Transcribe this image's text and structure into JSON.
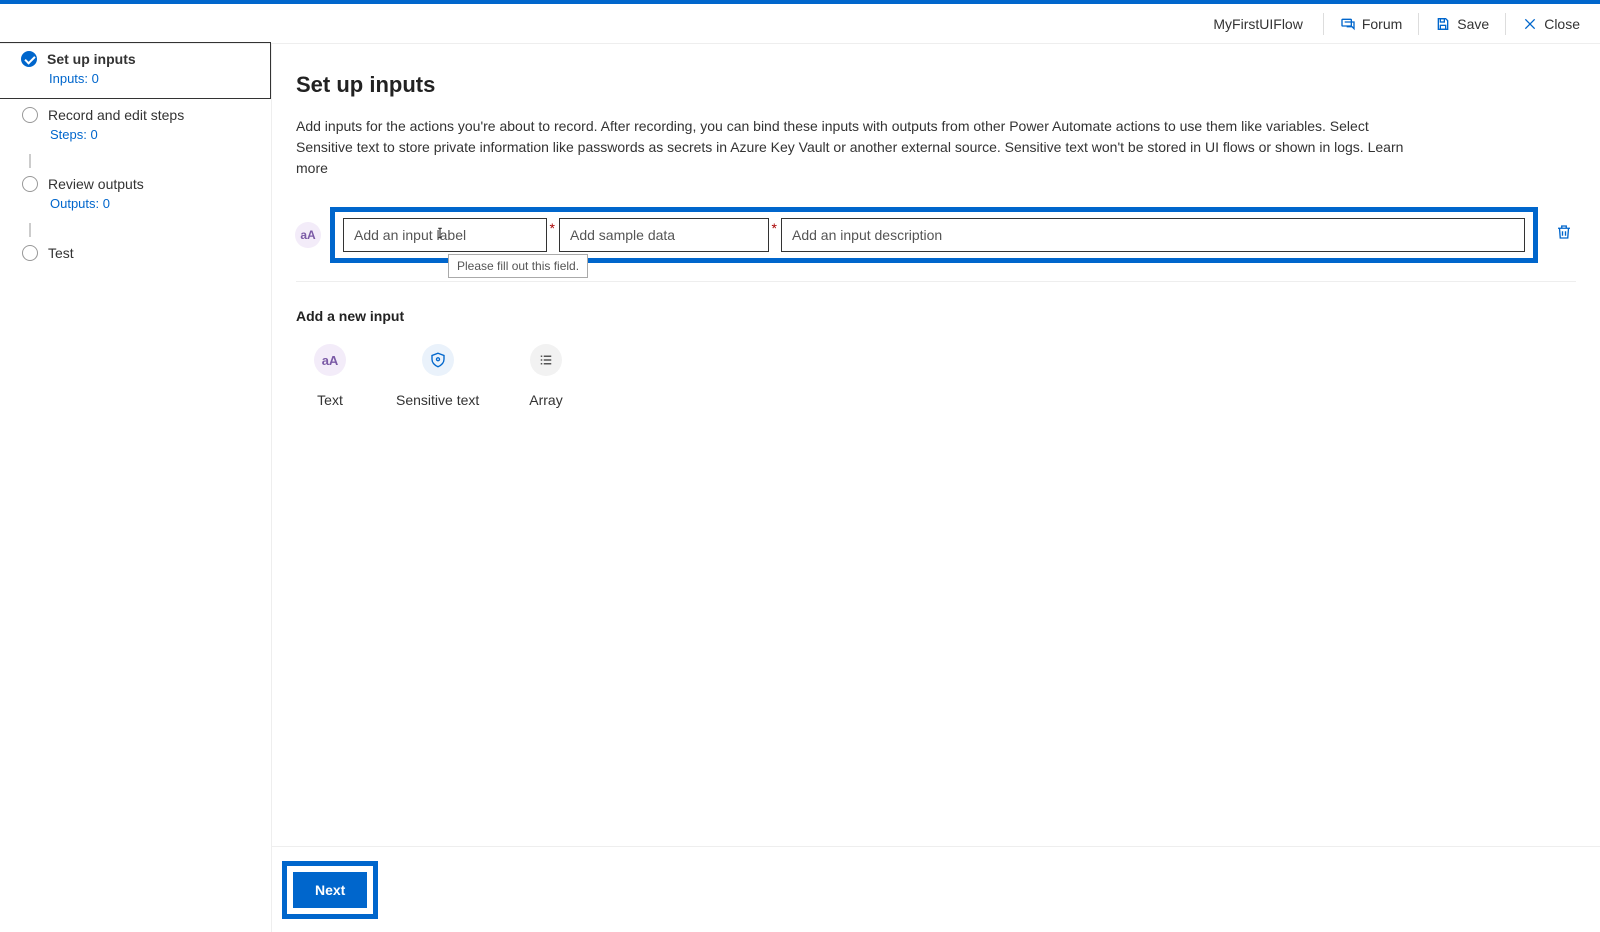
{
  "topbar": {
    "flow_title": "MyFirstUIFlow",
    "forum_label": "Forum",
    "save_label": "Save",
    "close_label": "Close"
  },
  "sidebar": {
    "step1": {
      "title": "Set up inputs",
      "sub": "Inputs: 0"
    },
    "step2": {
      "title": "Record and edit steps",
      "sub": "Steps: 0"
    },
    "step3": {
      "title": "Review outputs",
      "sub": "Outputs: 0"
    },
    "step4": {
      "title": "Test"
    }
  },
  "main": {
    "title": "Set up inputs",
    "description": "Add inputs for the actions you're about to record. After recording, you can bind these inputs with outputs from other Power Automate actions to use them like variables. Select Sensitive text to store private information like passwords as secrets in Azure Key Vault or another external source. Sensitive text won't be stored in UI flows or shown in logs. Learn more",
    "input_row": {
      "type_badge": "aA",
      "label_placeholder": "Add an input label",
      "sample_placeholder": "Add sample data",
      "desc_placeholder": "Add an input description",
      "tooltip": "Please fill out this field."
    },
    "add_new_title": "Add a new input",
    "types": {
      "text": "Text",
      "sensitive": "Sensitive text",
      "array": "Array"
    }
  },
  "footer": {
    "next_label": "Next"
  }
}
